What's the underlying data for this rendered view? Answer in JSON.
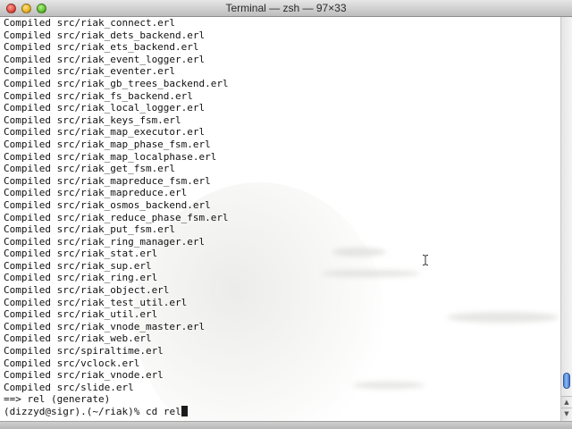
{
  "window": {
    "title": "Terminal — zsh — 97×33"
  },
  "terminal": {
    "lines": [
      "Compiled src/riak_connect.erl",
      "Compiled src/riak_dets_backend.erl",
      "Compiled src/riak_ets_backend.erl",
      "Compiled src/riak_event_logger.erl",
      "Compiled src/riak_eventer.erl",
      "Compiled src/riak_gb_trees_backend.erl",
      "Compiled src/riak_fs_backend.erl",
      "Compiled src/riak_local_logger.erl",
      "Compiled src/riak_keys_fsm.erl",
      "Compiled src/riak_map_executor.erl",
      "Compiled src/riak_map_phase_fsm.erl",
      "Compiled src/riak_map_localphase.erl",
      "Compiled src/riak_get_fsm.erl",
      "Compiled src/riak_mapreduce_fsm.erl",
      "Compiled src/riak_mapreduce.erl",
      "Compiled src/riak_osmos_backend.erl",
      "Compiled src/riak_reduce_phase_fsm.erl",
      "Compiled src/riak_put_fsm.erl",
      "Compiled src/riak_ring_manager.erl",
      "Compiled src/riak_stat.erl",
      "Compiled src/riak_sup.erl",
      "Compiled src/riak_ring.erl",
      "Compiled src/riak_object.erl",
      "Compiled src/riak_test_util.erl",
      "Compiled src/riak_util.erl",
      "Compiled src/riak_vnode_master.erl",
      "Compiled src/riak_web.erl",
      "Compiled src/spiraltime.erl",
      "Compiled src/vclock.erl",
      "Compiled src/riak_vnode.erl",
      "Compiled src/slide.erl",
      "==> rel (generate)"
    ],
    "prompt": "(dizzyd@sigr).(~/riak)% ",
    "command": "cd rel"
  },
  "scrollbar": {
    "thumb_position_fraction": 0.94
  },
  "icons": {
    "close": "close-button-icon",
    "minimize": "minimize-button-icon",
    "zoom": "zoom-button-icon",
    "pointer": "ibeam-cursor-icon"
  },
  "colors": {
    "close": "#e24b41",
    "minimize": "#e8b021",
    "zoom": "#5fbf2e",
    "text": "#111111",
    "scroll_thumb": "#4f86d8"
  }
}
